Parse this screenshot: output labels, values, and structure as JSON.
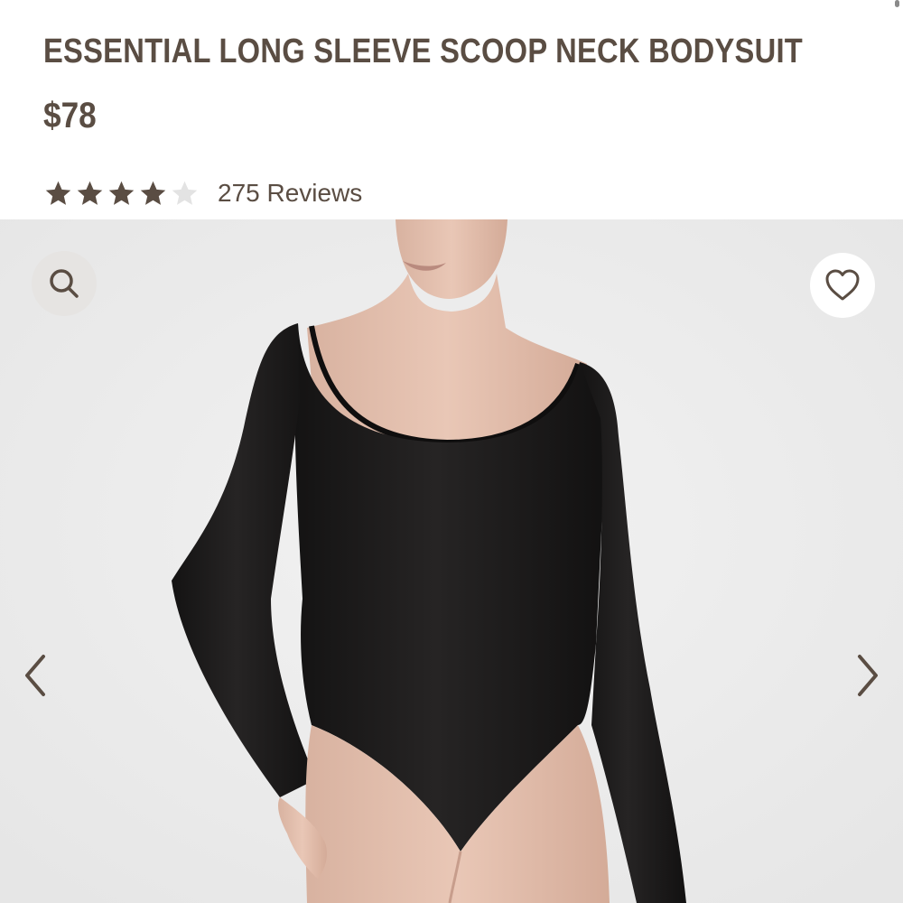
{
  "product": {
    "title": "ESSENTIAL LONG SLEEVE SCOOP NECK BODYSUIT",
    "price": "$78",
    "rating": {
      "value": 4,
      "max": 5,
      "reviews_label": "275 Reviews"
    }
  },
  "gallery": {
    "image_subject": "model wearing black long sleeve scoop neck bodysuit",
    "controls": {
      "search_icon": "search-icon",
      "favorite_icon": "heart-icon",
      "prev_icon": "chevron-left-icon",
      "next_icon": "chevron-right-icon"
    }
  },
  "colors": {
    "text": "#5a4d43",
    "star_filled": "#5a4d43",
    "star_empty": "#e3e3e3",
    "gallery_background": "#ededed",
    "garment": "#1b1a1a"
  }
}
